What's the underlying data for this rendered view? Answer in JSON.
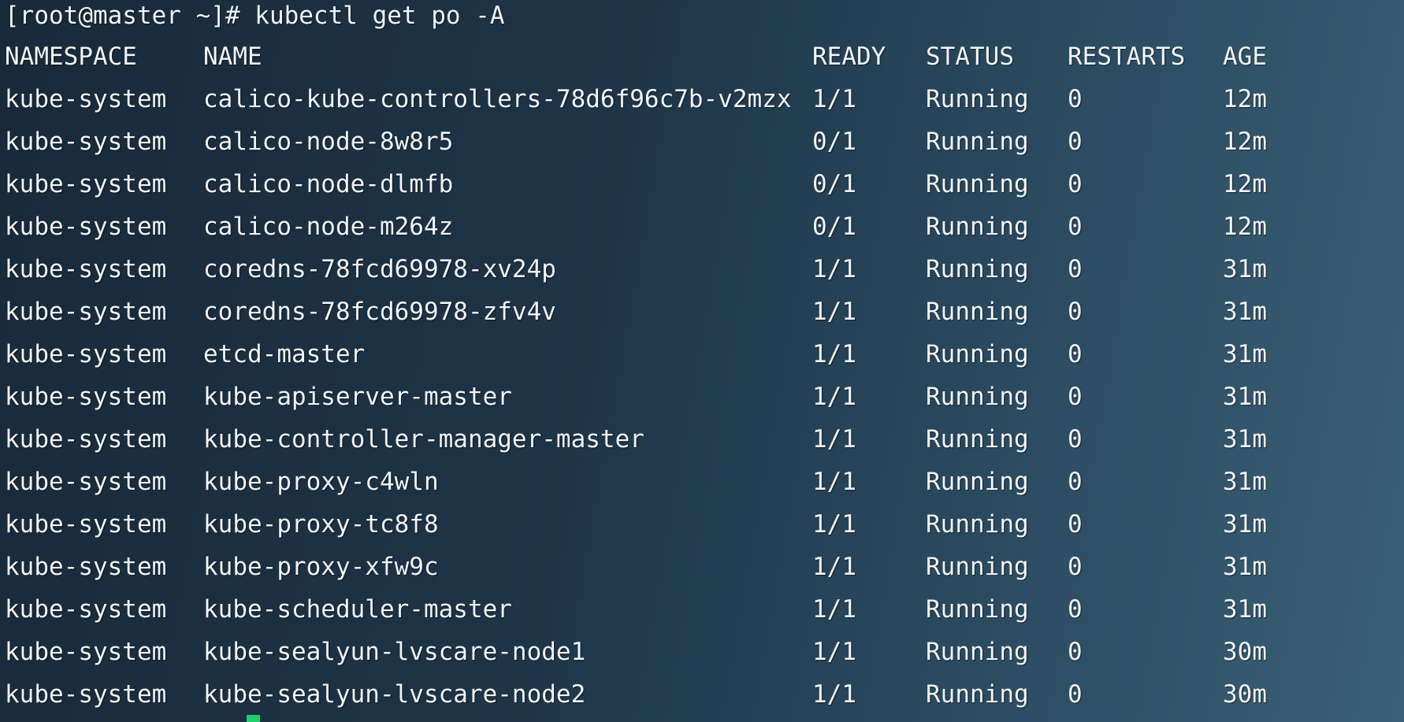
{
  "terminal": {
    "prompt": "[root@master ~]# kubectl get po -A",
    "headers": {
      "namespace": "NAMESPACE",
      "name": "NAME",
      "ready": "READY",
      "status": "STATUS",
      "restarts": "RESTARTS",
      "age": "AGE"
    },
    "rows": [
      {
        "namespace": "kube-system",
        "name": "calico-kube-controllers-78d6f96c7b-v2mzx",
        "ready": "1/1",
        "status": "Running",
        "restarts": "0",
        "age": "12m"
      },
      {
        "namespace": "kube-system",
        "name": "calico-node-8w8r5",
        "ready": "0/1",
        "status": "Running",
        "restarts": "0",
        "age": "12m"
      },
      {
        "namespace": "kube-system",
        "name": "calico-node-dlmfb",
        "ready": "0/1",
        "status": "Running",
        "restarts": "0",
        "age": "12m"
      },
      {
        "namespace": "kube-system",
        "name": "calico-node-m264z",
        "ready": "0/1",
        "status": "Running",
        "restarts": "0",
        "age": "12m"
      },
      {
        "namespace": "kube-system",
        "name": "coredns-78fcd69978-xv24p",
        "ready": "1/1",
        "status": "Running",
        "restarts": "0",
        "age": "31m"
      },
      {
        "namespace": "kube-system",
        "name": "coredns-78fcd69978-zfv4v",
        "ready": "1/1",
        "status": "Running",
        "restarts": "0",
        "age": "31m"
      },
      {
        "namespace": "kube-system",
        "name": "etcd-master",
        "ready": "1/1",
        "status": "Running",
        "restarts": "0",
        "age": "31m"
      },
      {
        "namespace": "kube-system",
        "name": "kube-apiserver-master",
        "ready": "1/1",
        "status": "Running",
        "restarts": "0",
        "age": "31m"
      },
      {
        "namespace": "kube-system",
        "name": "kube-controller-manager-master",
        "ready": "1/1",
        "status": "Running",
        "restarts": "0",
        "age": "31m"
      },
      {
        "namespace": "kube-system",
        "name": "kube-proxy-c4wln",
        "ready": "1/1",
        "status": "Running",
        "restarts": "0",
        "age": "31m"
      },
      {
        "namespace": "kube-system",
        "name": "kube-proxy-tc8f8",
        "ready": "1/1",
        "status": "Running",
        "restarts": "0",
        "age": "31m"
      },
      {
        "namespace": "kube-system",
        "name": "kube-proxy-xfw9c",
        "ready": "1/1",
        "status": "Running",
        "restarts": "0",
        "age": "31m"
      },
      {
        "namespace": "kube-system",
        "name": "kube-scheduler-master",
        "ready": "1/1",
        "status": "Running",
        "restarts": "0",
        "age": "31m"
      },
      {
        "namespace": "kube-system",
        "name": "kube-sealyun-lvscare-node1",
        "ready": "1/1",
        "status": "Running",
        "restarts": "0",
        "age": "30m"
      },
      {
        "namespace": "kube-system",
        "name": "kube-sealyun-lvscare-node2",
        "ready": "1/1",
        "status": "Running",
        "restarts": "0",
        "age": "30m"
      }
    ],
    "cursor_color": "#1fcf6f"
  }
}
